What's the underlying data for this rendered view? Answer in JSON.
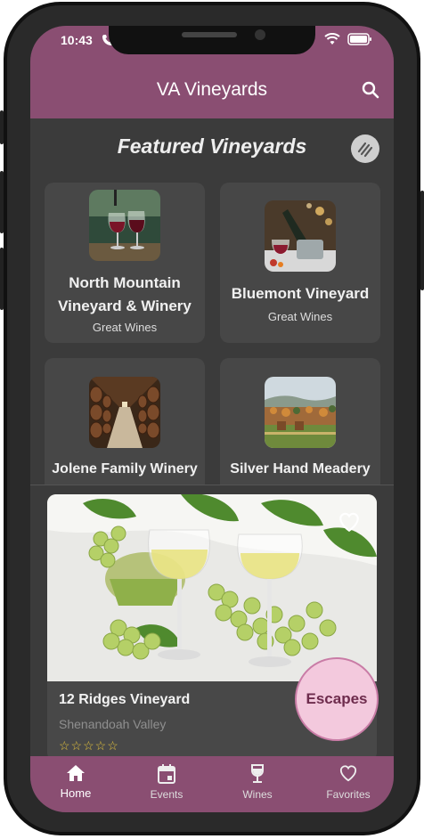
{
  "status": {
    "time": "10:43"
  },
  "appbar": {
    "title": "VA Vineyards"
  },
  "section": {
    "title": "Featured Vineyards"
  },
  "vineyards": [
    {
      "name": "North Mountain Vineyard & Winery",
      "subtitle": "Great Wines"
    },
    {
      "name": "Bluemont Vineyard",
      "subtitle": "Great Wines"
    },
    {
      "name": "Jolene Family Winery",
      "subtitle": ""
    },
    {
      "name": "Silver Hand Meadery",
      "subtitle": ""
    }
  ],
  "feature": {
    "name": "12 Ridges Vineyard",
    "location": "Shenandoah Valley",
    "stars": "☆☆☆☆☆"
  },
  "fab": {
    "label": "Escapes"
  },
  "nav": [
    {
      "label": "Home",
      "icon": "home-icon",
      "active": true
    },
    {
      "label": "Events",
      "icon": "calendar-icon"
    },
    {
      "label": "Wines",
      "icon": "wine-glass-icon"
    },
    {
      "label": "Favorites",
      "icon": "heart-icon"
    }
  ],
  "colors": {
    "brand": "#8a4e72",
    "fab": "#f3c9dd",
    "background": "#3b3b3b"
  }
}
